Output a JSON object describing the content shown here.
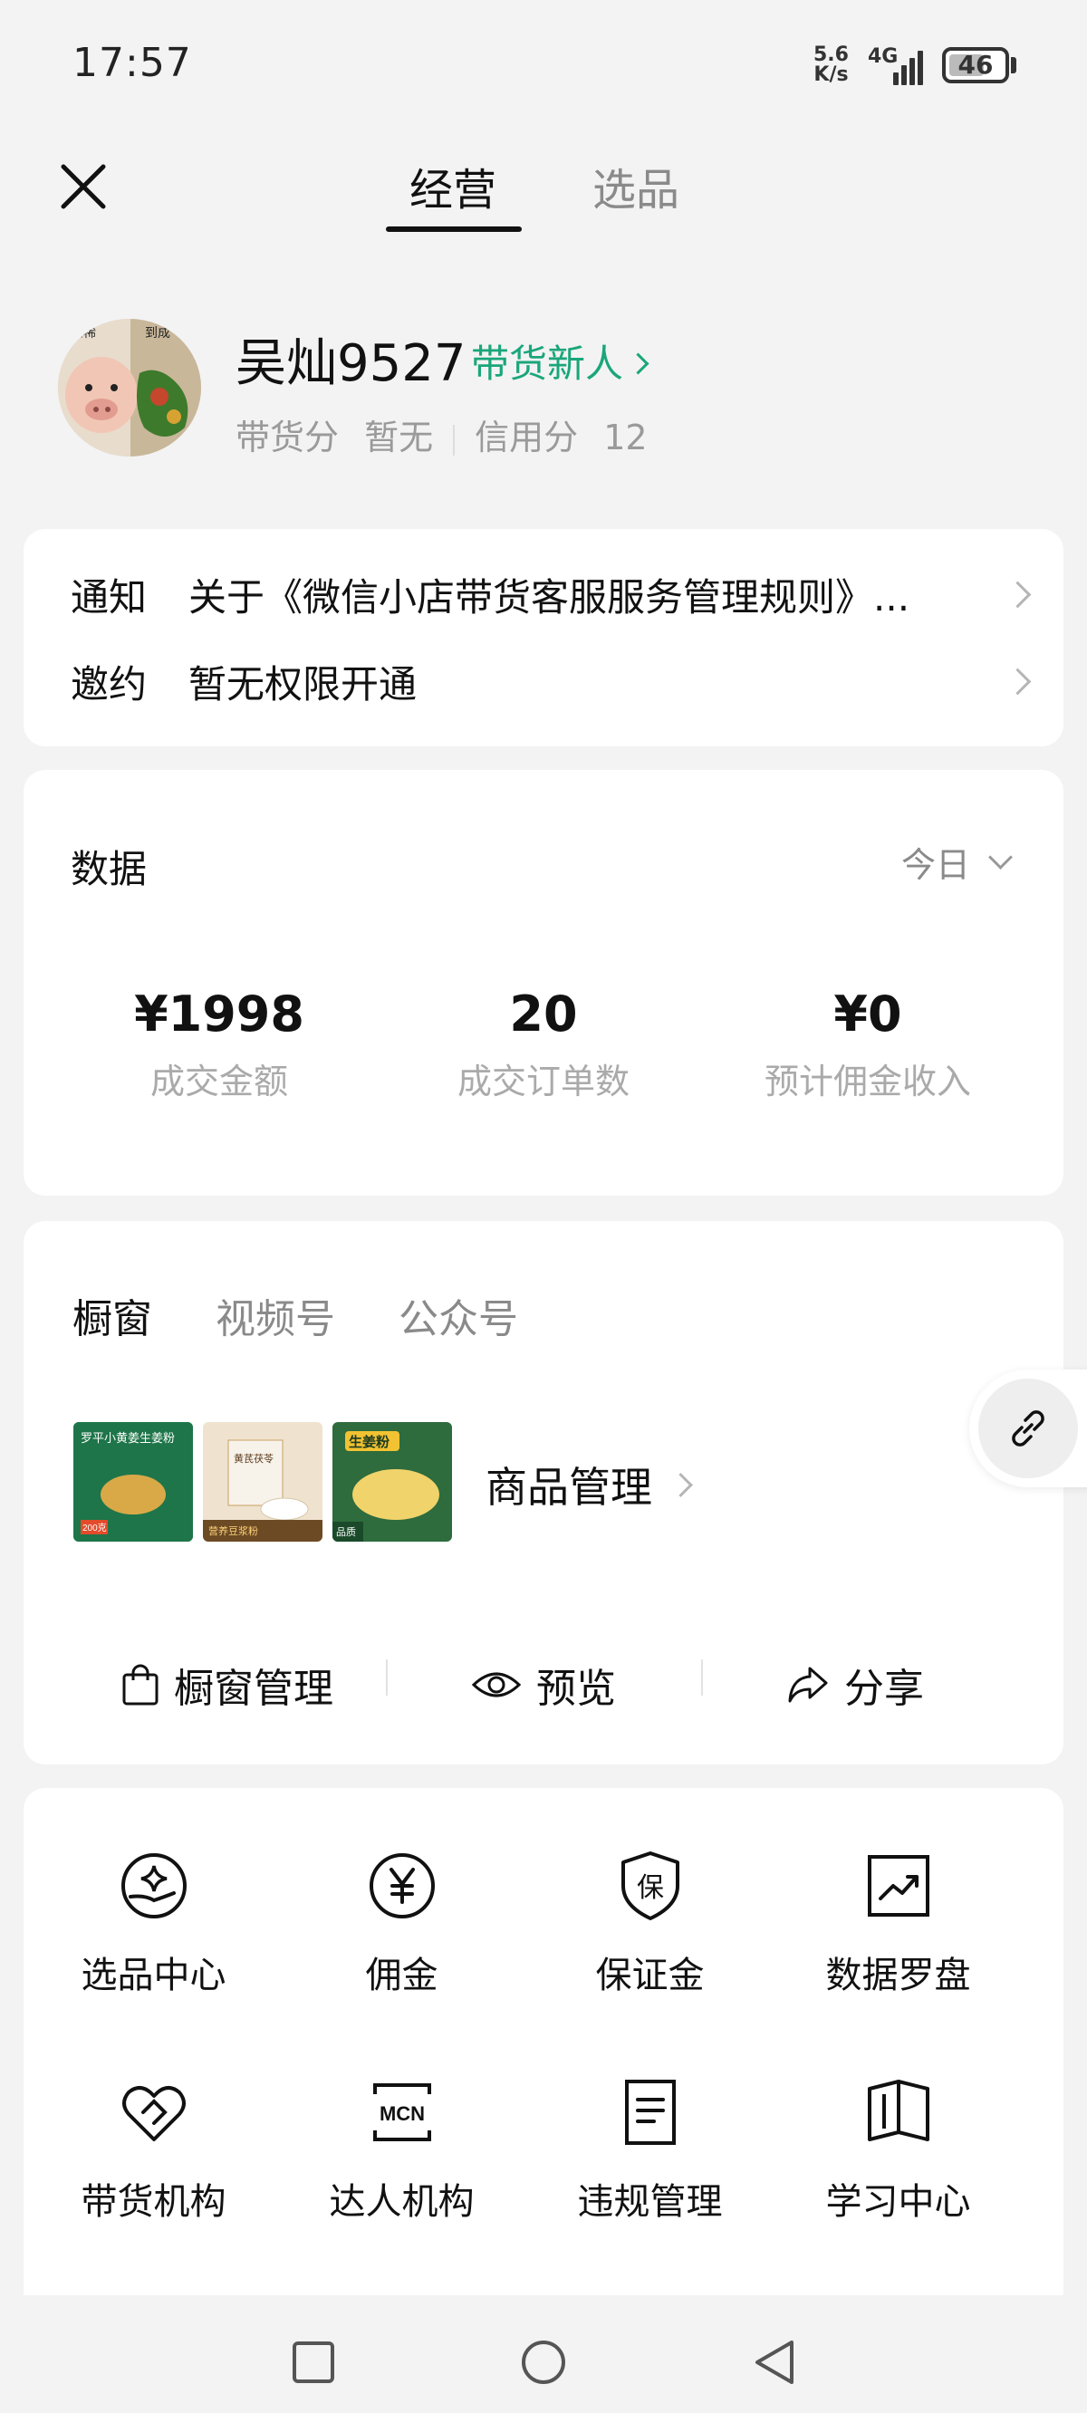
{
  "status_bar": {
    "time": "17:57",
    "net_speed_value": "5.6",
    "net_speed_unit": "K/s",
    "network": "4G",
    "battery": "46"
  },
  "header": {
    "close_icon": "close-icon",
    "tabs": [
      {
        "label": "经营",
        "active": true
      },
      {
        "label": "选品",
        "active": false
      }
    ]
  },
  "profile": {
    "name": "吴灿9527",
    "badge": "带货新人",
    "score_label": "带货分",
    "score_value": "暂无",
    "credit_label": "信用分",
    "credit_value": "12",
    "avatar_text_left": "和稀",
    "avatar_text_right": "到成"
  },
  "notices": [
    {
      "label": "通知",
      "text": "关于《微信小店带货客服服务管理规则》..."
    },
    {
      "label": "邀约",
      "text": "暂无权限开通"
    }
  ],
  "data_panel": {
    "title": "数据",
    "range": "今日",
    "metrics": [
      {
        "value": "¥1998",
        "label": "成交金额"
      },
      {
        "value": "20",
        "label": "成交订单数"
      },
      {
        "value": "¥0",
        "label": "预计佣金收入"
      }
    ]
  },
  "showcase": {
    "tabs": [
      {
        "label": "橱窗",
        "active": true
      },
      {
        "label": "视频号",
        "active": false
      },
      {
        "label": "公众号",
        "active": false
      }
    ],
    "products": [
      {
        "title": "罗平小黄姜生姜粉",
        "tag": "200克"
      },
      {
        "title": "黄芪茯苓",
        "tag": "营养豆浆粉"
      },
      {
        "title": "生姜粉",
        "tag": "品质"
      }
    ],
    "manage_label": "商品管理",
    "actions": [
      {
        "label": "橱窗管理",
        "icon": "bag-icon"
      },
      {
        "label": "预览",
        "icon": "eye-icon"
      },
      {
        "label": "分享",
        "icon": "share-icon"
      }
    ]
  },
  "grid": [
    {
      "label": "选品中心",
      "icon": "sparkle-hand-icon"
    },
    {
      "label": "佣金",
      "icon": "yen-circle-icon"
    },
    {
      "label": "保证金",
      "icon": "shield-bao-icon",
      "glyph": "保"
    },
    {
      "label": "数据罗盘",
      "icon": "trend-chart-icon"
    },
    {
      "label": "带货机构",
      "icon": "heart-handshake-icon"
    },
    {
      "label": "达人机构",
      "icon": "mcn-icon",
      "glyph": "MCN"
    },
    {
      "label": "违规管理",
      "icon": "document-icon"
    },
    {
      "label": "学习中心",
      "icon": "book-icon"
    }
  ],
  "float_button": {
    "icon": "link-icon"
  },
  "nav": {
    "recent_icon": "square-icon",
    "home_icon": "circle-icon",
    "back_icon": "back-triangle-icon"
  }
}
